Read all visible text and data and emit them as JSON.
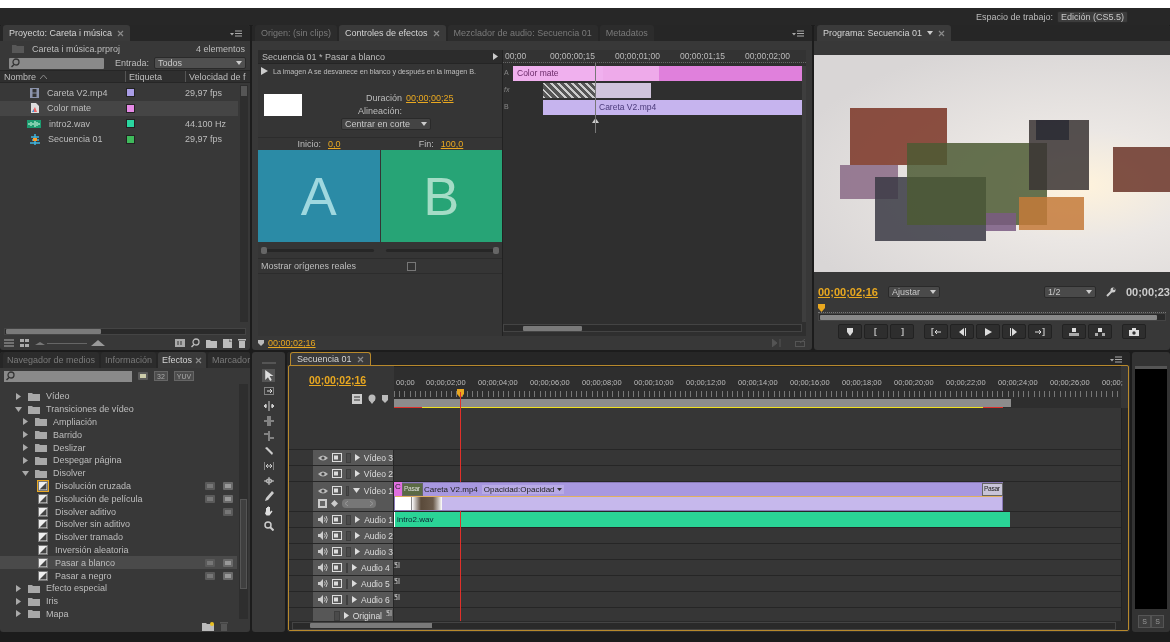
{
  "workspace": {
    "label": "Espacio de trabajo:",
    "value": "Edición (CS5.5)"
  },
  "project": {
    "tab": "Proyecto: Careta i música",
    "file": "Careta i música.prproj",
    "count": "4 elementos",
    "filter_label": "Entrada:",
    "filter_value": "Todos",
    "columns": [
      "Nombre",
      "Etiqueta",
      "Velocidad de f"
    ],
    "items": [
      {
        "kind": "video",
        "name": "Careta V2.mp4",
        "color": "#a99de6",
        "rate": "29,97 fps",
        "selected": false
      },
      {
        "kind": "matte",
        "name": "Color mate",
        "color": "#e68ae6",
        "selected": true
      },
      {
        "kind": "audio",
        "name": "intro2.wav",
        "color": "#2ad6a0",
        "rate": "44.100 Hz",
        "selected": false
      },
      {
        "kind": "sequence",
        "name": "Secuencia 01",
        "color": "#3fba5c",
        "rate": "29,97 fps",
        "selected": false
      }
    ]
  },
  "effect_controls": {
    "tabs": [
      {
        "label": "Origen: (sin clips)",
        "selected": false
      },
      {
        "label": "Controles de efectos",
        "selected": true
      },
      {
        "label": "Mezclador de audio: Secuencia 01",
        "selected": false
      },
      {
        "label": "Metadatos",
        "selected": false
      }
    ],
    "header": "Secuencia 01 * Pasar a blanco",
    "description": "La imagen A se desvanece en blanco y después en la imagen B.",
    "duration_label": "Duración",
    "duration": "00;00;00;25",
    "alignment_label": "Alineación:",
    "alignment": "Centrar en corte",
    "start_label": "Inicio:",
    "start": "0,0",
    "end_label": "Fin:",
    "end": "100,0",
    "preview_a": "A",
    "preview_b": "B",
    "start_slider": {
      "level": 0
    },
    "end_slider": {
      "level": 1
    },
    "show_sources": {
      "label": "Mostrar orígenes reales",
      "checked": false
    },
    "ruler": [
      "00;00",
      "00;00;00;15",
      "00;00;01;00",
      "00;00;01;15",
      "00;00;02;00"
    ],
    "track_labels": [
      "A",
      "fx",
      "B"
    ],
    "clips": [
      "Color mate",
      "Careta V2.mp4"
    ],
    "timecode": "00;00;02;16"
  },
  "program": {
    "tab": "Programa: Secuencia 01",
    "timecode": "00;00;02;16",
    "zoom": "Ajustar",
    "resolution": "1/2",
    "duration": "00;00;23"
  },
  "effects": {
    "tabs": [
      {
        "label": "Navegador de medios",
        "selected": false
      },
      {
        "label": "Información",
        "selected": false
      },
      {
        "label": "Efectos",
        "selected": true
      },
      {
        "label": "Marcador",
        "selected": false
      }
    ],
    "filter_buttons": [
      "32",
      "YUV"
    ],
    "tree": [
      {
        "kind": "folder",
        "label": "Vídeo",
        "expanded": false
      },
      {
        "kind": "folder",
        "label": "Transiciones de vídeo",
        "expanded": true,
        "children": [
          {
            "kind": "folder",
            "label": "Ampliación",
            "expanded": false
          },
          {
            "kind": "folder",
            "label": "Barrido",
            "expanded": false
          },
          {
            "kind": "folder",
            "label": "Deslizar",
            "expanded": false
          },
          {
            "kind": "folder",
            "label": "Despegar página",
            "expanded": false
          },
          {
            "kind": "folder",
            "label": "Disolver",
            "expanded": true,
            "children": [
              {
                "kind": "effect",
                "label": "Disolución cruzada",
                "selected": false,
                "default": true,
                "accelerated": true,
                "bit32": true
              },
              {
                "kind": "effect",
                "label": "Disolución de película",
                "selected": false,
                "default": false,
                "accelerated": true,
                "bit32": true
              },
              {
                "kind": "effect",
                "label": "Disolver aditivo",
                "selected": false,
                "default": false,
                "accelerated": true,
                "bit32": false
              },
              {
                "kind": "effect",
                "label": "Disolver sin aditivo",
                "selected": false,
                "default": false,
                "accelerated": false,
                "bit32": false
              },
              {
                "kind": "effect",
                "label": "Disolver tramado",
                "selected": false,
                "default": false,
                "accelerated": false,
                "bit32": false
              },
              {
                "kind": "effect",
                "label": "Inversión aleatoria",
                "selected": false,
                "default": false,
                "accelerated": false,
                "bit32": false
              },
              {
                "kind": "effect",
                "label": "Pasar a blanco",
                "selected": true,
                "default": false,
                "accelerated": true,
                "bit32": true
              },
              {
                "kind": "effect",
                "label": "Pasar a negro",
                "selected": false,
                "default": false,
                "accelerated": true,
                "bit32": true
              }
            ]
          }
        ]
      },
      {
        "kind": "folder",
        "label": "Efecto especial",
        "expanded": false
      },
      {
        "kind": "folder",
        "label": "Iris",
        "expanded": false
      },
      {
        "kind": "folder",
        "label": "Mapa",
        "expanded": false
      }
    ]
  },
  "timeline": {
    "tab": "Secuencia 01",
    "timecode": "00;00;02;16",
    "ruler": [
      "00;00",
      "00;00;02;00",
      "00;00;04;00",
      "00;00;06;00",
      "00;00;08;00",
      "00;00;10;00",
      "00;00;12;00",
      "00;00;14;00",
      "00;00;16;00",
      "00;00;18;00",
      "00;00;20;00",
      "00;00;22;00",
      "00;00;24;00",
      "00;00;26;00",
      "00;00;"
    ],
    "tracks": [
      {
        "kind": "video",
        "name": "Vídeo 3",
        "expanded": false
      },
      {
        "kind": "video",
        "name": "Vídeo 2",
        "expanded": false
      },
      {
        "kind": "video",
        "name": "Vídeo 1",
        "expanded": true,
        "clips": [
          {
            "kind": "matte",
            "label": "C"
          },
          {
            "kind": "transition",
            "label": "Pasar"
          },
          {
            "kind": "video",
            "label": "Careta V2.mp4",
            "effect": "Opacidad:Opacidad"
          },
          {
            "kind": "transition",
            "label": "Pasar"
          }
        ]
      },
      {
        "kind": "audio",
        "name": "Audio 1",
        "expanded": false,
        "surround": false,
        "clips": [
          {
            "kind": "audio",
            "label": "intro2.wav"
          }
        ]
      },
      {
        "kind": "audio",
        "name": "Audio 2",
        "expanded": false,
        "surround": false
      },
      {
        "kind": "audio",
        "name": "Audio 3",
        "expanded": false,
        "surround": false
      },
      {
        "kind": "audio",
        "name": "Audio 4",
        "expanded": false,
        "surround": true
      },
      {
        "kind": "audio",
        "name": "Audio 5",
        "expanded": false,
        "surround": true
      },
      {
        "kind": "audio",
        "name": "Audio 6",
        "expanded": false,
        "surround": true
      },
      {
        "kind": "master",
        "name": "Original",
        "expanded": false,
        "surround": true
      }
    ]
  },
  "meter": {
    "buttons": [
      "S",
      "S"
    ]
  }
}
